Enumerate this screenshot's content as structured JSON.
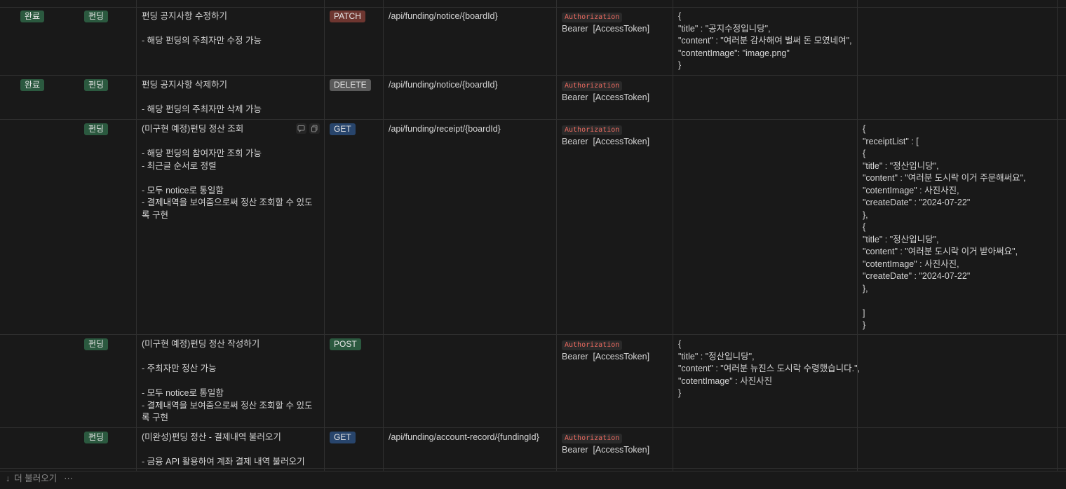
{
  "rows": [
    {
      "status": "완료",
      "category": "펀딩",
      "desc": [
        "펀딩 공지사항 수정하기",
        "",
        "- 해당 펀딩의 주최자만 수정 가능"
      ],
      "method": "PATCH",
      "url": "/api/funding/notice/{boardId}",
      "header_key": "Authorization",
      "header_value": "Bearer  [AccessToken]",
      "request": [
        "{",
        "\"title\" : \"공지수정입니당\",",
        "\"content\" : \"여러분 감사해여 벌써 돈 모였네여\",",
        "\"contentImage\": \"image.png\"",
        "}"
      ],
      "response": []
    },
    {
      "status": "완료",
      "category": "펀딩",
      "desc": [
        "펀딩 공지사항 삭제하기",
        "",
        "- 해당 펀딩의 주최자만 삭제 가능"
      ],
      "method": "DELETE",
      "url": "/api/funding/notice/{boardId}",
      "header_key": "Authorization",
      "header_value": "Bearer  [AccessToken]",
      "request": [],
      "response": []
    },
    {
      "status": "",
      "category": "펀딩",
      "desc": [
        "(미구현 예정)펀딩 정산 조회",
        "",
        "- 해당 펀딩의 참여자만 조회 가능",
        "- 최근글 순서로 정렬",
        "",
        "- 모두 notice로 통일함",
        "- 결제내역을 보여줌으로써 정산 조회할 수 있도록 구현"
      ],
      "method": "GET",
      "url": "/api/funding/receipt/{boardId}",
      "header_key": "Authorization",
      "header_value": "Bearer  [AccessToken]",
      "request": [],
      "response": [
        "{",
        "\"receiptList\" : [",
        "{",
        "\"title\" : \"정산입니당\",",
        "\"content\" : \"여러분 도시락 이거 주문해써요\",",
        "\"cotentImage\" : 사진사진,",
        "\"createDate\" : \"2024-07-22\"",
        "},",
        "{",
        "\"title\" : \"정산입니당\",",
        "\"content\" : \"여러분 도시락 이거 받아써요\",",
        "\"cotentImage\" : 사진사진,",
        "\"createDate\" : \"2024-07-22\"",
        "},",
        "",
        "]",
        "}"
      ]
    },
    {
      "status": "",
      "category": "펀딩",
      "desc": [
        "(미구현 예정)펀딩 정산 작성하기",
        "",
        "- 주최자만 정산 가능",
        "",
        "- 모두 notice로 통일함",
        "- 결제내역을 보여줌으로써 정산 조회할 수 있도록 구현"
      ],
      "method": "POST",
      "url": "",
      "header_key": "Authorization",
      "header_value": "Bearer  [AccessToken]",
      "request": [
        "{",
        "\"title\" : \"정산입니당\",",
        "\"content\" : \"여러분 뉴진스 도시락 수령했습니다.\",",
        "\"cotentImage\" : 사진사진",
        "}"
      ],
      "response": []
    },
    {
      "status": "",
      "category": "펀딩",
      "desc": [
        "(미완성)펀딩 정산 - 결제내역 불러오기",
        "",
        "- 금융 API 활용하여 계좌 결제 내역 불러오기"
      ],
      "method": "GET",
      "url": "/api/funding/account-record/{fundingId}",
      "header_key": "Authorization",
      "header_value": "Bearer  [AccessToken]",
      "request": [],
      "response": []
    }
  ],
  "footer": {
    "load_more": "더 불러오기",
    "more_icon": "⋯",
    "arrow_icon": "↓"
  },
  "colors": {
    "background": "#191919",
    "border": "#2f2f2f",
    "tag_green": "#2b593f",
    "tag_red": "#6e3630",
    "tag_gray": "#5a5a5a",
    "tag_blue": "#28456c",
    "code_text": "#ea6a60"
  }
}
